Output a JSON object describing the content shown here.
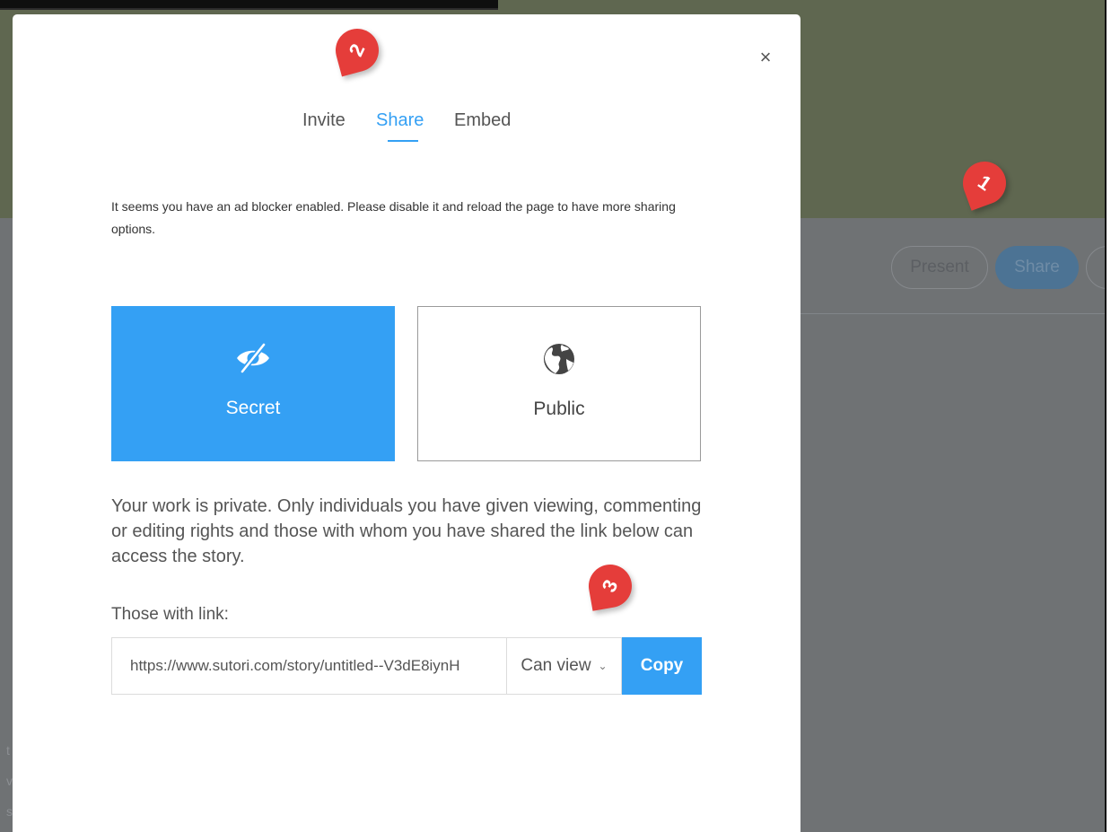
{
  "background_page": {
    "present_label": "Present",
    "share_label": "Share",
    "fragments": [
      "t",
      "v",
      "s"
    ]
  },
  "modal": {
    "close_label": "×",
    "tabs": [
      {
        "label": "Invite",
        "active": false
      },
      {
        "label": "Share",
        "active": true
      },
      {
        "label": "Embed",
        "active": false
      }
    ],
    "adblock_notice": "It seems you have an ad blocker enabled. Please disable it and reload the page to have more sharing options.",
    "visibility": {
      "selected": "Secret",
      "secret": {
        "label": "Secret",
        "icon": "eye-slash-icon"
      },
      "public": {
        "label": "Public",
        "icon": "globe-icon"
      }
    },
    "private_description": "Your work is private. Only individuals you have given viewing, commenting or editing rights and those with whom you have shared the link below can access the story.",
    "link_label": "Those with link:",
    "link_value": "https://www.sutori.com/story/untitled--V3dE8iynH",
    "permission_selected": "Can view",
    "copy_label": "Copy"
  },
  "annotations": [
    {
      "number": "1"
    },
    {
      "number": "2"
    },
    {
      "number": "3"
    }
  ],
  "colors": {
    "accent": "#34a0f4",
    "pin": "#e53d3a",
    "header_bg": "#5f6750",
    "overlay_bg": "#6f7274"
  }
}
